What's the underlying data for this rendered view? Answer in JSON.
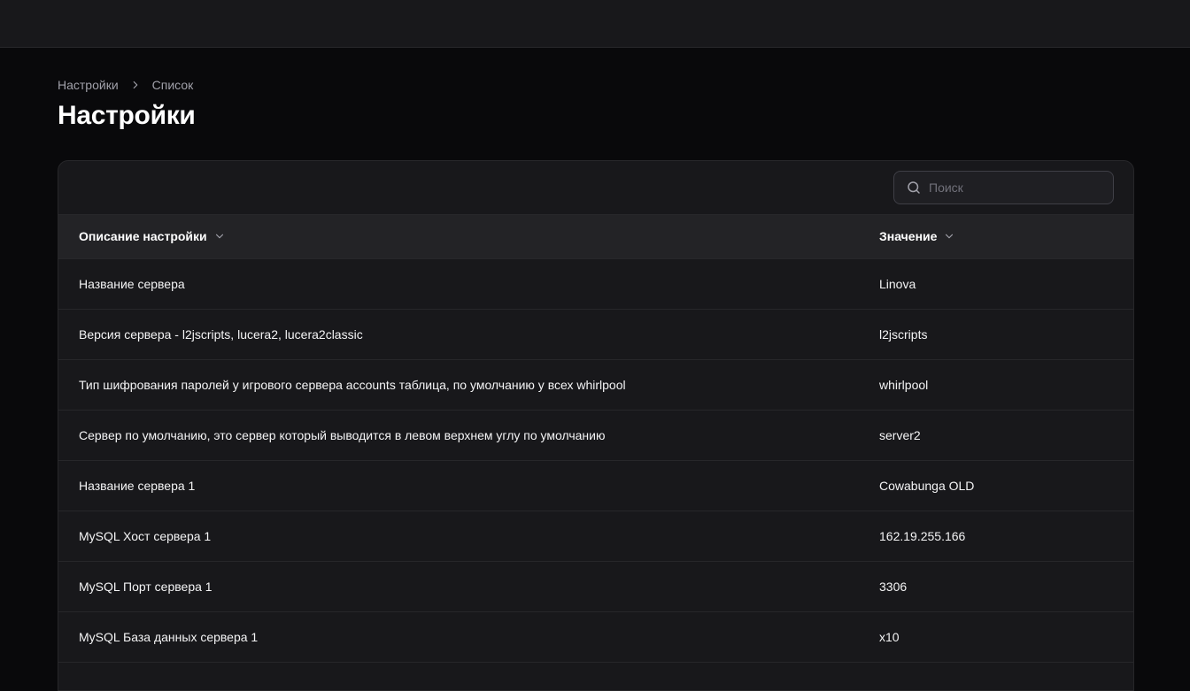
{
  "breadcrumb": {
    "items": [
      "Настройки",
      "Список"
    ]
  },
  "page": {
    "title": "Настройки"
  },
  "search": {
    "placeholder": "Поиск",
    "icon": "search-icon"
  },
  "table": {
    "columns": [
      "Описание настройки",
      "Значение"
    ],
    "rows": [
      {
        "description": "Название сервера",
        "value": "Linova"
      },
      {
        "description": "Версия сервера - l2jscripts, lucera2, lucera2classic",
        "value": "l2jscripts"
      },
      {
        "description": "Тип шифрования паролей у игрового сервера accounts таблица, по умолчанию у всех whirlpool",
        "value": "whirlpool"
      },
      {
        "description": "Сервер по умолчанию, это сервер который выводится в левом верхнем углу по умолчанию",
        "value": "server2"
      },
      {
        "description": "Название сервера 1",
        "value": "Cowabunga OLD"
      },
      {
        "description": "MySQL Хост сервера 1",
        "value": "162.19.255.166"
      },
      {
        "description": "MySQL Порт сервера 1",
        "value": "3306"
      },
      {
        "description": "MySQL База данных сервера 1",
        "value": "x10"
      }
    ]
  },
  "colors": {
    "background": "#09090b",
    "surface": "#18181b",
    "header_row": "#232326",
    "border": "#27272a",
    "muted_text": "#a1a1aa"
  }
}
